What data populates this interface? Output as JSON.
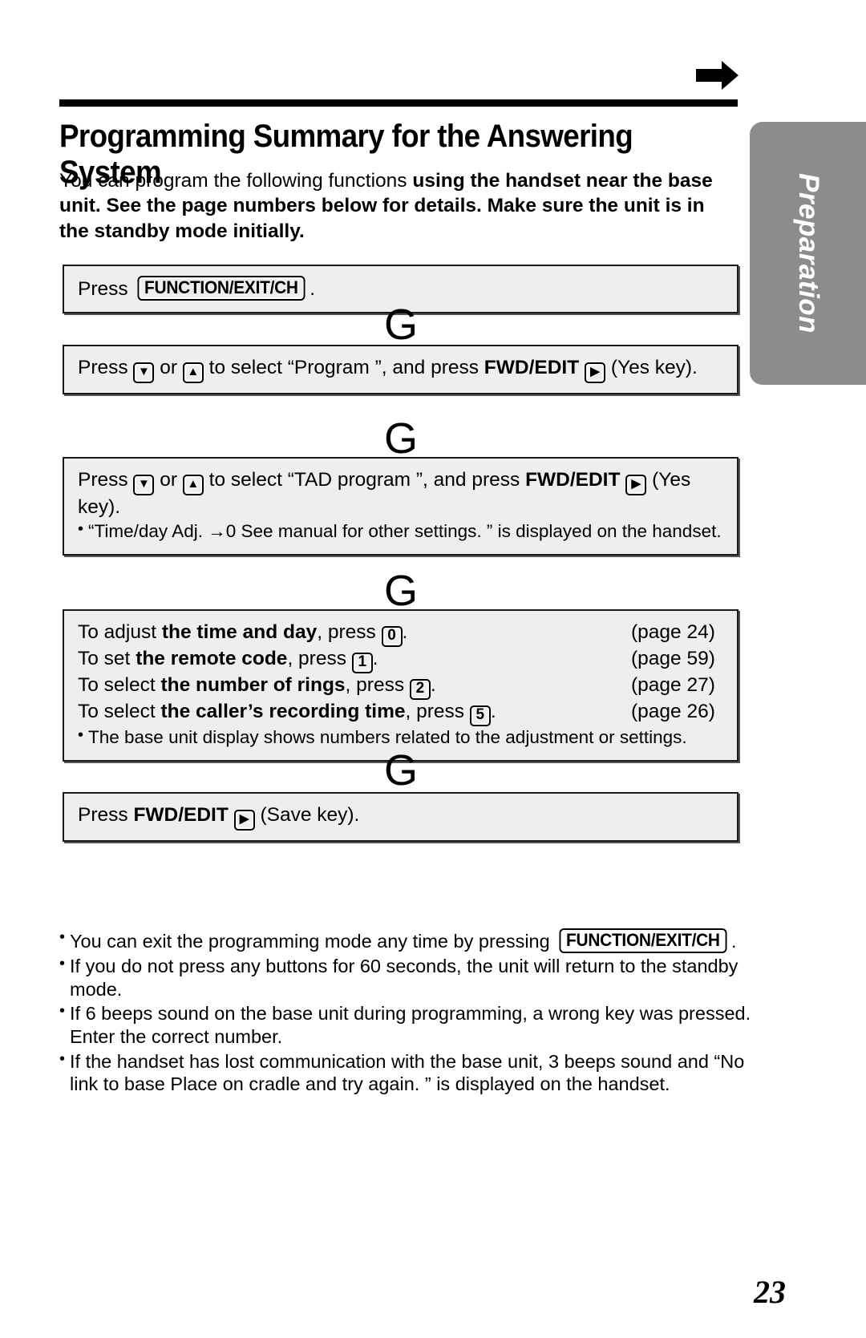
{
  "header": {
    "arrow_icon": "right-arrow-icon"
  },
  "side_tab": {
    "label": "Preparation"
  },
  "page": {
    "title": "Programming Summary for the Answering System",
    "number": "23"
  },
  "intro": {
    "normal_1": "You can program the following functions ",
    "bold_1": "using the handset near the base unit. See the page numbers below for details. Make sure the unit is in the standby mode initially."
  },
  "flow_arrow": "G",
  "steps": [
    {
      "name": "press-function-exit-ch",
      "pre": "Press ",
      "key": "FUNCTION/EXIT/CH",
      "post": "."
    },
    {
      "name": "select-program",
      "pre": "Press ",
      "key_down": "▼",
      "mid_or": " or ",
      "key_up": "▲",
      "mid_select": " to select “Program ”, and press ",
      "fwd_edit": "FWD/EDIT",
      "key_right": "▶",
      "post": " (Yes key)."
    },
    {
      "name": "select-tad-program",
      "pre": "Press ",
      "key_down": "▼",
      "mid_or": " or ",
      "key_up": "▲",
      "mid_select": " to select “TAD program ”, and press ",
      "fwd_edit": "FWD/EDIT",
      "key_right": "▶",
      "post": " (Yes key).",
      "note": "“Time/day Adj.    →0 See manual for other settings.             ” is displayed on the handset."
    },
    {
      "name": "adjust-options",
      "rows": [
        {
          "pre": "To adjust ",
          "bold": "the time and day",
          "mid": ", press ",
          "key": "0",
          "post": ".",
          "page_ref": "(page 24)"
        },
        {
          "pre": "To set ",
          "bold": "the remote code",
          "mid": ", press ",
          "key": "1",
          "post": ".",
          "page_ref": "(page 59)"
        },
        {
          "pre": "To select ",
          "bold": "the number of rings",
          "mid": ", press ",
          "key": "2",
          "post": ".",
          "page_ref": "(page 27)"
        },
        {
          "pre": "To select ",
          "bold": "the caller’s recording time",
          "mid": ", press ",
          "key": "5",
          "post": ".",
          "page_ref": "(page 26)"
        }
      ],
      "note": "The base unit display shows numbers related to the adjustment or settings."
    },
    {
      "name": "press-save",
      "pre": "Press ",
      "fwd_edit": "FWD/EDIT",
      "key_right": "▶",
      "post": " (Save key)."
    }
  ],
  "bullets": [
    {
      "pre": "You can exit the programming mode any time by pressing ",
      "key": "FUNCTION/EXIT/CH",
      "post": "."
    },
    {
      "pre": "If you do not press any buttons for 60 seconds, the unit will return to the standby mode.",
      "key": "",
      "post": ""
    },
    {
      "pre": "If 6 beeps sound on the base unit during programming, a wrong key was pressed. Enter the correct number.",
      "key": "",
      "post": ""
    },
    {
      "pre": "If the handset has lost communication with the base unit, 3 beeps sound and “No link to base Place on cradle and try again.                 ” is displayed on the handset.",
      "key": "",
      "post": ""
    }
  ]
}
